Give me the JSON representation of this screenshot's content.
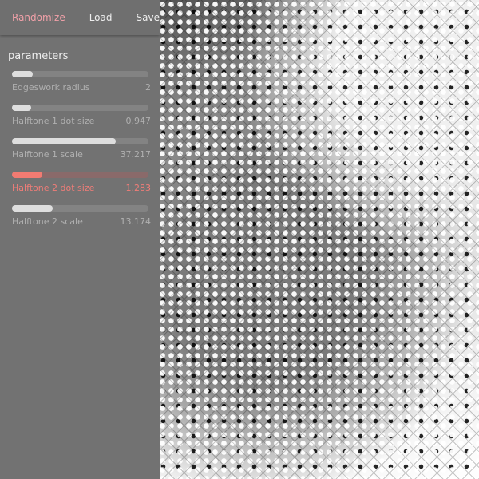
{
  "toolbar": {
    "randomize_label": "Randomize",
    "load_label": "Load",
    "save_label": "Save"
  },
  "panel": {
    "section_title": "parameters",
    "params": [
      {
        "label": "Edgeswork radius",
        "value": "2",
        "level": 0.15
      },
      {
        "label": "Halftone 1 dot size",
        "value": "0.947",
        "level": 0.14
      },
      {
        "label": "Halftone 1 scale",
        "value": "37.217",
        "level": 0.76
      },
      {
        "label": "Halftone 2 dot size",
        "value": "1.283",
        "level": 0.22,
        "active": true
      },
      {
        "label": "Halftone 2 scale",
        "value": "13.174",
        "level": 0.3
      }
    ]
  },
  "colors": {
    "accent": "#f27b72",
    "randomize": "#f0a0a8",
    "panel_bg": "#727272"
  },
  "icons": []
}
